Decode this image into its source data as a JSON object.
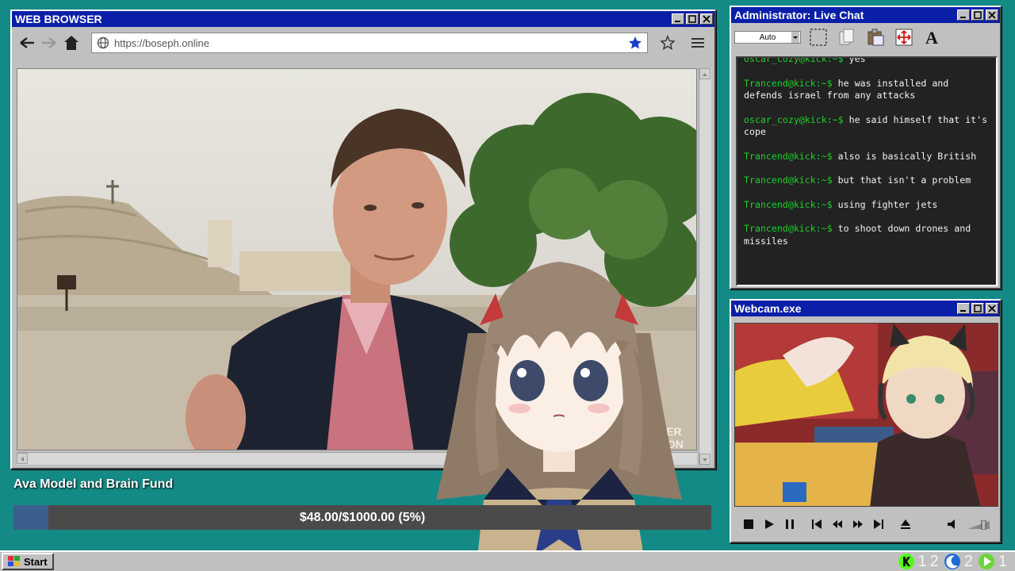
{
  "browser": {
    "title": "WEB BROWSER",
    "url": "https://boseph.online",
    "icons": [
      "back-arrow-icon",
      "forward-arrow-icon",
      "home-icon",
      "globe-icon",
      "bookmarked-star-icon",
      "star-icon",
      "menu-icon"
    ],
    "video_watermark": "KER\nGON"
  },
  "chat": {
    "title": "Administrator: Live Chat",
    "font_select": "Auto",
    "messages": [
      {
        "user": "oscar_cozy@kick:~$",
        "text": " yes"
      },
      {
        "user": "Trancend@kick:~$",
        "text": " he was installed and defends israel from any attacks"
      },
      {
        "user": "oscar_cozy@kick:~$",
        "text": " he said himself that it's cope"
      },
      {
        "user": "Trancend@kick:~$",
        "text": " also is basically British"
      },
      {
        "user": "Trancend@kick:~$",
        "text": " but that isn't a problem"
      },
      {
        "user": "Trancend@kick:~$",
        "text": " using fighter jets"
      },
      {
        "user": "Trancend@kick:~$",
        "text": " to shoot down drones and missiles"
      }
    ],
    "colors": {
      "user": "#1fcf2b",
      "text": "#f2f2f2",
      "bg": "#222222"
    }
  },
  "webcam": {
    "title": "Webcam.exe"
  },
  "fund": {
    "title": "Ava Model and Brain Fund",
    "amount_text": "$48.00/$1000.00 (5%)",
    "progress": 0.05
  },
  "taskbar": {
    "start_label": "Start",
    "tray": [
      {
        "icon": "kick-icon",
        "count": "1"
      },
      {
        "icon": "moon-icon",
        "count": "2"
      },
      {
        "icon": "play-icon",
        "count": "1"
      }
    ],
    "tray_first_sep": "2"
  },
  "colors": {
    "desktop": "#138a85",
    "titlebar": "#0a1fa8",
    "fund_fill": "#3a5f8c"
  }
}
